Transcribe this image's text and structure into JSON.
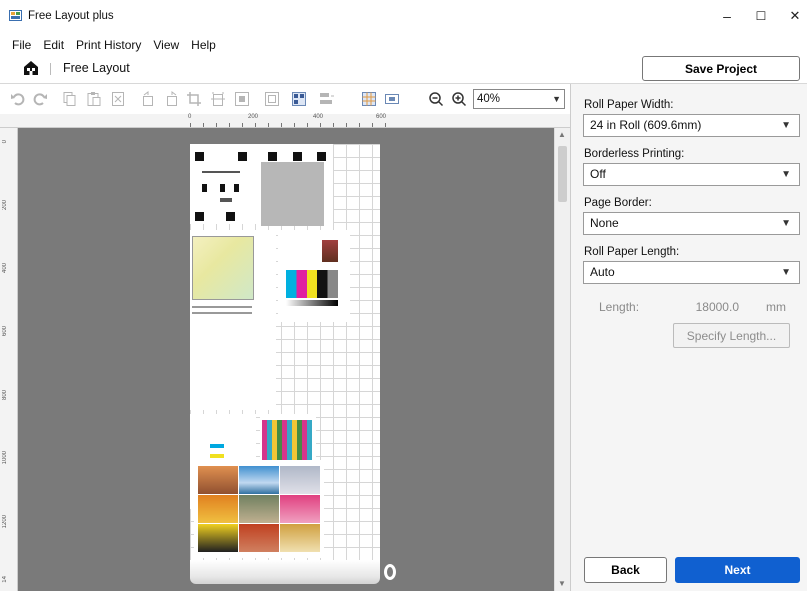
{
  "window": {
    "title": "Free Layout plus",
    "controls": {
      "minimize": "–",
      "maximize": "☐",
      "close": "✕"
    }
  },
  "menu": [
    "File",
    "Edit",
    "Print History",
    "View",
    "Help"
  ],
  "header": {
    "title": "Free Layout",
    "save_label": "Save Project",
    "home_icon": "home-icon"
  },
  "toolbar": {
    "icons": [
      "undo-icon",
      "redo-icon",
      "copy-icon",
      "paste-icon",
      "delete-icon",
      "rotate-left-icon",
      "rotate-right-icon",
      "crop-icon",
      "trim-icon",
      "fit-icon",
      "fullscreen-icon",
      "auto-layout-icon",
      "align-icon",
      "grid-icon",
      "preview-icon",
      "zoom-out-icon",
      "zoom-in-icon"
    ],
    "zoom": "40%"
  },
  "ruler": {
    "top_ticks": [
      "0",
      "200",
      "400",
      "600"
    ],
    "left_ticks": [
      "0",
      "200",
      "400",
      "600",
      "800",
      "1000",
      "1200",
      "14"
    ]
  },
  "panel": {
    "roll_width": {
      "label": "Roll Paper Width:",
      "value": "24 in Roll (609.6mm)"
    },
    "borderless": {
      "label": "Borderless Printing:",
      "value": "Off"
    },
    "page_border": {
      "label": "Page Border:",
      "value": "None"
    },
    "roll_length": {
      "label": "Roll Paper Length:",
      "value": "Auto"
    },
    "length": {
      "label": "Length:",
      "value": "18000.0",
      "unit": "mm"
    },
    "specify_label": "Specify Length..."
  },
  "footer": {
    "back_label": "Back",
    "next_label": "Next"
  },
  "colors": {
    "accent": "#1060d0",
    "canvas": "#7a7a7a"
  }
}
